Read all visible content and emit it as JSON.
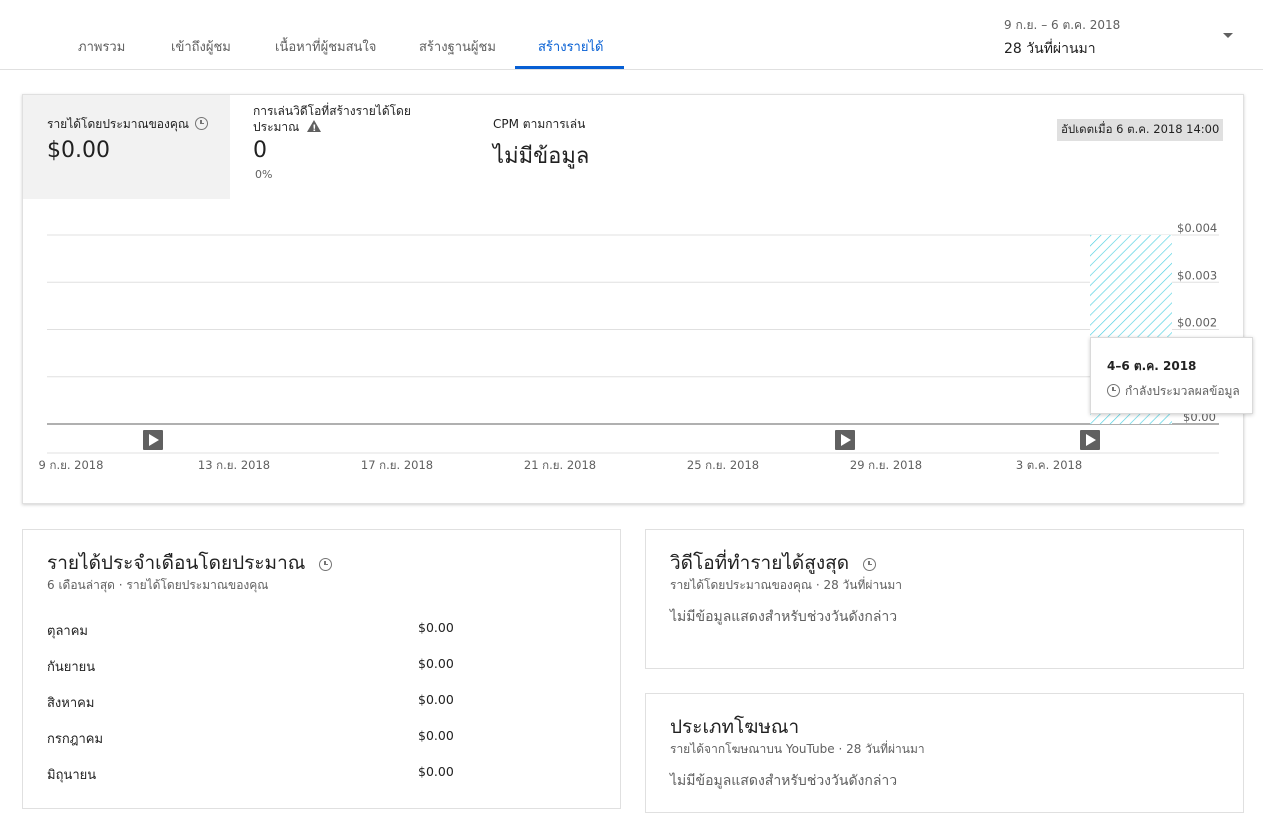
{
  "tabs": [
    {
      "label": "ภาพรวม",
      "active": false
    },
    {
      "label": "เข้าถึงผู้ชม",
      "active": false
    },
    {
      "label": "เนื้อหาที่ผู้ชมสนใจ",
      "active": false
    },
    {
      "label": "สร้างฐานผู้ชม",
      "active": false
    },
    {
      "label": "สร้างรายได้",
      "active": true
    }
  ],
  "date_range": {
    "range": "9 ก.ย. – 6 ต.ค. 2018",
    "label": "28 วันที่ผ่านมา"
  },
  "colors": {
    "accent": "#065fd4",
    "chart_fill": "#4dd0e1",
    "active_metric_bg": "#f2f2f2"
  },
  "metrics": {
    "revenue": {
      "label": "รายได้โดยประมาณของคุณ",
      "value": "$0.00"
    },
    "monetized_playbacks": {
      "label_line1": "การเล่นวิดีโอที่สร้างรายได้โดย",
      "label_line2": "ประมาณ",
      "value": "0",
      "sub": "0%"
    },
    "cpm": {
      "label": "CPM ตามการเล่น",
      "value": "ไม่มีข้อมูล"
    },
    "updated": "อัปเดตเมื่อ 6 ต.ค. 2018 14:00"
  },
  "chart_data": {
    "type": "bar",
    "x_tick_labels": [
      "9 ก.ย. 2018",
      "13 ก.ย. 2018",
      "17 ก.ย. 2018",
      "21 ก.ย. 2018",
      "25 ก.ย. 2018",
      "29 ก.ย. 2018",
      "3 ต.ค. 2018"
    ],
    "y_tick_labels": [
      "$0.004",
      "$0.003",
      "$0.002",
      "$0.00"
    ],
    "ylim": [
      0,
      0.004
    ],
    "series": [
      {
        "values": [
          0,
          0,
          0,
          0,
          0,
          0,
          0
        ]
      }
    ],
    "processing_bar": {
      "label": "4–6 ต.ค. 2018",
      "fills_to": 0.004,
      "pattern": "diagonal-hatch"
    },
    "video_markers": [
      "11 ก.ย. 2018",
      "28 ก.ย. 2018",
      "4 ต.ค. 2018"
    ],
    "grid": true
  },
  "tooltip": {
    "title": "4–6 ต.ค. 2018",
    "status": "กำลังประมวลผลข้อมูล"
  },
  "monthly": {
    "title": "รายได้ประจำเดือนโดยประมาณ",
    "subtitle": "6 เดือนล่าสุด · รายได้โดยประมาณของคุณ",
    "rows": [
      {
        "month": "ตุลาคม",
        "value": "$0.00"
      },
      {
        "month": "กันยายน",
        "value": "$0.00"
      },
      {
        "month": "สิงหาคม",
        "value": "$0.00"
      },
      {
        "month": "กรกฎาคม",
        "value": "$0.00"
      },
      {
        "month": "มิถุนายน",
        "value": "$0.00"
      }
    ]
  },
  "top_videos": {
    "title": "วิดีโอที่ทำรายได้สูงสุด",
    "subtitle": "รายได้โดยประมาณของคุณ · 28 วันที่ผ่านมา",
    "empty": "ไม่มีข้อมูลแสดงสำหรับช่วงวันดังกล่าว"
  },
  "ad_types": {
    "title": "ประเภทโฆษณา",
    "subtitle": "รายได้จากโฆษณาบน YouTube · 28 วันที่ผ่านมา",
    "empty": "ไม่มีข้อมูลแสดงสำหรับช่วงวันดังกล่าว"
  }
}
